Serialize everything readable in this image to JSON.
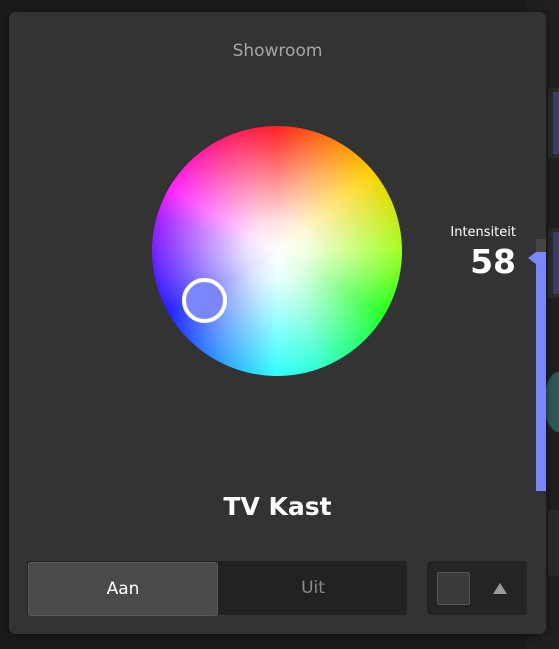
{
  "dialog": {
    "room_title": "Showroom",
    "device_name": "TV Kast"
  },
  "intensity": {
    "label": "Intensiteit",
    "value": "58",
    "level_percent": 58
  },
  "color": {
    "selected_hex": "#7c86fb",
    "accent": "#7c86fb"
  },
  "toggle": {
    "on_label": "Aan",
    "off_label": "Uit",
    "selected": "on"
  },
  "icons": {
    "expand": "triangle-up-icon"
  }
}
